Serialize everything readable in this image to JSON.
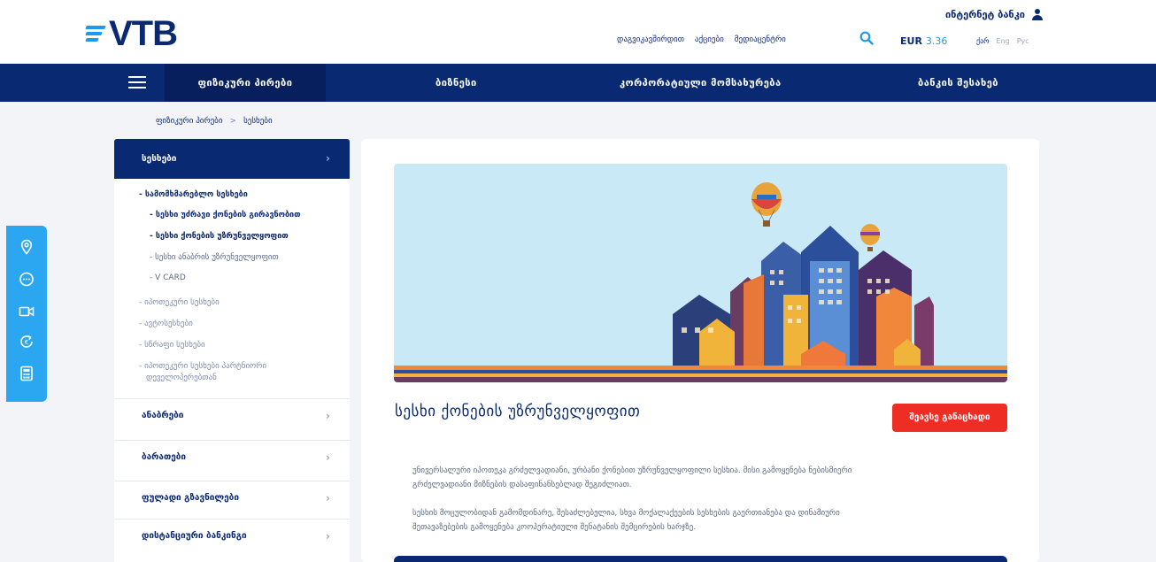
{
  "header": {
    "brand": "VTB",
    "login_label": "ინტერნეტ ბანკი",
    "top_links": [
      "დაგვიკავშირდით",
      "აქციები",
      "მედიაცენტრი"
    ],
    "currency": {
      "code": "EUR",
      "rate": "3.36"
    },
    "languages": [
      "ქარ",
      "Eng",
      "Рус"
    ],
    "active_language": "ქარ"
  },
  "nav": {
    "items": [
      "ფიზიკური პირები",
      "ბიზნესი",
      "კორპორატიული მომსახურება",
      "ბანკის შესახებ"
    ],
    "active": "ფიზიკური პირები"
  },
  "breadcrumb": [
    "ფიზიკური პირები",
    "სესხები"
  ],
  "breadcrumb_separator": ">",
  "sidebar": {
    "header": "სესხები",
    "submenu": [
      {
        "label": "- სამომხმარებლო სესხები",
        "style": "bold"
      },
      {
        "label": "- სესხი უძრავი ქონების გირავნობით",
        "style": "bold"
      },
      {
        "label": "- სესხი ქონების უზრუნველყოფით",
        "style": "bold-active"
      },
      {
        "label": "- სესხი ანაბრის უზრუნველყოფით",
        "style": "normal"
      },
      {
        "label": "- V CARD",
        "style": "normal"
      },
      {
        "label": "- იპოთეკური სესხები",
        "style": "muted"
      },
      {
        "label": "- ავტოსესხები",
        "style": "muted"
      },
      {
        "label": "- სწრაფი სესხები",
        "style": "muted"
      },
      {
        "label": "- იპოთეკური სესხები პარტნიორი",
        "style": "muted"
      },
      {
        "label": "დეველოპერებთან",
        "style": "muted"
      }
    ],
    "rows": [
      "ანაბრები",
      "ბარათები",
      "ფულადი გზავნილები",
      "დისტანციური ბანკინგი"
    ]
  },
  "float_bar_icons": [
    "location-icon",
    "chat-icon",
    "video-icon",
    "exchange-icon",
    "calculator-icon"
  ],
  "product": {
    "title": "სესხი ქონების უზრუნველყოფით",
    "apply_label": "შეავსე განაცხადი",
    "paragraphs": [
      "უნივერსალური იპოთეკა გრძელვადიანი, ურბანი ქონებით უზრუნველყოფილი სესხია. მისი გამოყენება ნებისმიერი",
      "გრძელვადიანი მიზნების დასაფინანსებლად შეგიძლიათ.",
      "სესხის მოცულობიდან გამომდინარე, შესაძლებელია, სხვა მოქალაქეების სესხების გაერთიანება და დინამიური",
      "შეთავაზებების გამოყენება კოოპერატიული შენატანის შემცირების ხარჯზე."
    ]
  },
  "colors": {
    "navy": "#0a2973",
    "accent_blue": "#1e9be8",
    "float_bar": "#2aa7f0",
    "apply_red": "#ee2e24"
  }
}
